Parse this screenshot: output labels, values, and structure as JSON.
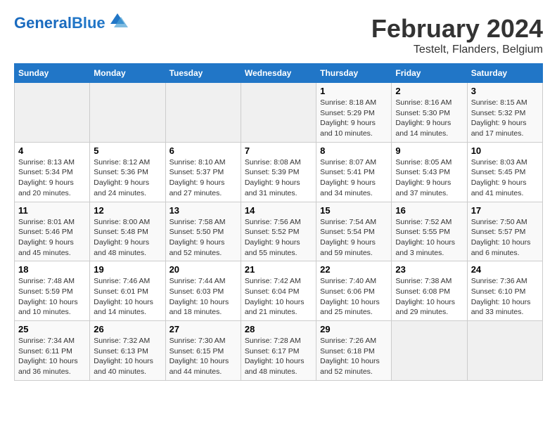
{
  "header": {
    "logo_text_general": "General",
    "logo_text_blue": "Blue",
    "month_title": "February 2024",
    "location": "Testelt, Flanders, Belgium"
  },
  "calendar": {
    "days_of_week": [
      "Sunday",
      "Monday",
      "Tuesday",
      "Wednesday",
      "Thursday",
      "Friday",
      "Saturday"
    ],
    "weeks": [
      [
        {
          "day": "",
          "info": ""
        },
        {
          "day": "",
          "info": ""
        },
        {
          "day": "",
          "info": ""
        },
        {
          "day": "",
          "info": ""
        },
        {
          "day": "1",
          "info": "Sunrise: 8:18 AM\nSunset: 5:29 PM\nDaylight: 9 hours\nand 10 minutes."
        },
        {
          "day": "2",
          "info": "Sunrise: 8:16 AM\nSunset: 5:30 PM\nDaylight: 9 hours\nand 14 minutes."
        },
        {
          "day": "3",
          "info": "Sunrise: 8:15 AM\nSunset: 5:32 PM\nDaylight: 9 hours\nand 17 minutes."
        }
      ],
      [
        {
          "day": "4",
          "info": "Sunrise: 8:13 AM\nSunset: 5:34 PM\nDaylight: 9 hours\nand 20 minutes."
        },
        {
          "day": "5",
          "info": "Sunrise: 8:12 AM\nSunset: 5:36 PM\nDaylight: 9 hours\nand 24 minutes."
        },
        {
          "day": "6",
          "info": "Sunrise: 8:10 AM\nSunset: 5:37 PM\nDaylight: 9 hours\nand 27 minutes."
        },
        {
          "day": "7",
          "info": "Sunrise: 8:08 AM\nSunset: 5:39 PM\nDaylight: 9 hours\nand 31 minutes."
        },
        {
          "day": "8",
          "info": "Sunrise: 8:07 AM\nSunset: 5:41 PM\nDaylight: 9 hours\nand 34 minutes."
        },
        {
          "day": "9",
          "info": "Sunrise: 8:05 AM\nSunset: 5:43 PM\nDaylight: 9 hours\nand 37 minutes."
        },
        {
          "day": "10",
          "info": "Sunrise: 8:03 AM\nSunset: 5:45 PM\nDaylight: 9 hours\nand 41 minutes."
        }
      ],
      [
        {
          "day": "11",
          "info": "Sunrise: 8:01 AM\nSunset: 5:46 PM\nDaylight: 9 hours\nand 45 minutes."
        },
        {
          "day": "12",
          "info": "Sunrise: 8:00 AM\nSunset: 5:48 PM\nDaylight: 9 hours\nand 48 minutes."
        },
        {
          "day": "13",
          "info": "Sunrise: 7:58 AM\nSunset: 5:50 PM\nDaylight: 9 hours\nand 52 minutes."
        },
        {
          "day": "14",
          "info": "Sunrise: 7:56 AM\nSunset: 5:52 PM\nDaylight: 9 hours\nand 55 minutes."
        },
        {
          "day": "15",
          "info": "Sunrise: 7:54 AM\nSunset: 5:54 PM\nDaylight: 9 hours\nand 59 minutes."
        },
        {
          "day": "16",
          "info": "Sunrise: 7:52 AM\nSunset: 5:55 PM\nDaylight: 10 hours\nand 3 minutes."
        },
        {
          "day": "17",
          "info": "Sunrise: 7:50 AM\nSunset: 5:57 PM\nDaylight: 10 hours\nand 6 minutes."
        }
      ],
      [
        {
          "day": "18",
          "info": "Sunrise: 7:48 AM\nSunset: 5:59 PM\nDaylight: 10 hours\nand 10 minutes."
        },
        {
          "day": "19",
          "info": "Sunrise: 7:46 AM\nSunset: 6:01 PM\nDaylight: 10 hours\nand 14 minutes."
        },
        {
          "day": "20",
          "info": "Sunrise: 7:44 AM\nSunset: 6:03 PM\nDaylight: 10 hours\nand 18 minutes."
        },
        {
          "day": "21",
          "info": "Sunrise: 7:42 AM\nSunset: 6:04 PM\nDaylight: 10 hours\nand 21 minutes."
        },
        {
          "day": "22",
          "info": "Sunrise: 7:40 AM\nSunset: 6:06 PM\nDaylight: 10 hours\nand 25 minutes."
        },
        {
          "day": "23",
          "info": "Sunrise: 7:38 AM\nSunset: 6:08 PM\nDaylight: 10 hours\nand 29 minutes."
        },
        {
          "day": "24",
          "info": "Sunrise: 7:36 AM\nSunset: 6:10 PM\nDaylight: 10 hours\nand 33 minutes."
        }
      ],
      [
        {
          "day": "25",
          "info": "Sunrise: 7:34 AM\nSunset: 6:11 PM\nDaylight: 10 hours\nand 36 minutes."
        },
        {
          "day": "26",
          "info": "Sunrise: 7:32 AM\nSunset: 6:13 PM\nDaylight: 10 hours\nand 40 minutes."
        },
        {
          "day": "27",
          "info": "Sunrise: 7:30 AM\nSunset: 6:15 PM\nDaylight: 10 hours\nand 44 minutes."
        },
        {
          "day": "28",
          "info": "Sunrise: 7:28 AM\nSunset: 6:17 PM\nDaylight: 10 hours\nand 48 minutes."
        },
        {
          "day": "29",
          "info": "Sunrise: 7:26 AM\nSunset: 6:18 PM\nDaylight: 10 hours\nand 52 minutes."
        },
        {
          "day": "",
          "info": ""
        },
        {
          "day": "",
          "info": ""
        }
      ]
    ]
  }
}
